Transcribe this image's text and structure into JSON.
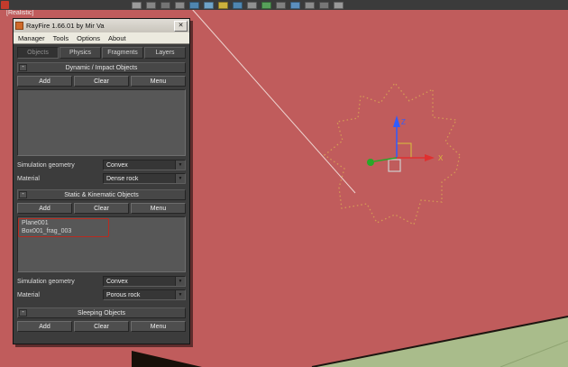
{
  "top_toolbar": {
    "icons": [
      "select-object-icon",
      "select-by-name-icon",
      "rectangle-selection-icon",
      "crossing-selection-icon",
      "select-and-move-icon",
      "select-and-rotate-icon",
      "select-and-scale-icon",
      "reference-coordinate-system-icon",
      "use-pivot-point-icon",
      "select-and-manipulate-icon",
      "snap-toggle-icon",
      "angle-snap-icon",
      "percent-snap-icon",
      "mirror-icon",
      "align-icon"
    ]
  },
  "viewport": {
    "shading_label": "[Realistic]",
    "gizmo": {
      "z_axis_label": "Z",
      "x_axis_label": "X"
    },
    "colors": {
      "plane_red": "#c05c5c",
      "ground_green": "#a9bc8b",
      "axis_x": "#e03030",
      "axis_y": "#28a828",
      "axis_z": "#2e5cff",
      "selection_outline": "#d49a55",
      "annotation_red": "#b92b20"
    }
  },
  "dialog": {
    "title": "RayFire 1.66.01  by Mir Va",
    "icons": {
      "close": "✕",
      "collapse": "-",
      "dropdown": "▼"
    },
    "menu": [
      "Manager",
      "Tools",
      "Options",
      "About"
    ],
    "tabs": [
      "Objects",
      "Physics",
      "Fragments",
      "Layers"
    ],
    "active_tab": "Objects",
    "sections": [
      {
        "title": "Dynamic / Impact Objects",
        "buttons": [
          "Add",
          "Clear",
          "Menu"
        ],
        "list_items": [],
        "fields": [
          {
            "label": "Simulation geometry",
            "value": "Convex"
          },
          {
            "label": "Material",
            "value": "Dense rock"
          }
        ]
      },
      {
        "title": "Static & Kinematic Objects",
        "buttons": [
          "Add",
          "Clear",
          "Menu"
        ],
        "list_items": [
          "Plane001",
          "Box001_frag_003"
        ],
        "fields": [
          {
            "label": "Simulation geometry",
            "value": "Convex"
          },
          {
            "label": "Material",
            "value": "Porous rock"
          }
        ]
      },
      {
        "title": "Sleeping Objects",
        "buttons": [
          "Add",
          "Clear",
          "Menu"
        ],
        "list_items": [],
        "fields": []
      }
    ]
  }
}
